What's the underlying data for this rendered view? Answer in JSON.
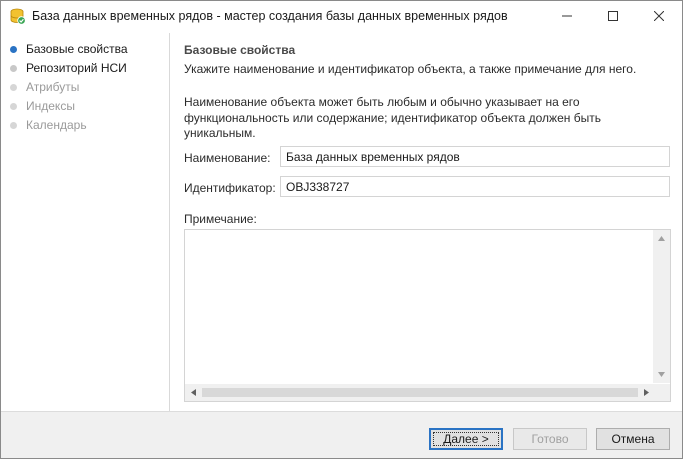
{
  "window": {
    "title": "База данных временных рядов - мастер создания базы данных временных рядов"
  },
  "steps": [
    {
      "label": "Базовые свойства",
      "state": "active"
    },
    {
      "label": "Репозиторий НСИ",
      "state": "done"
    },
    {
      "label": "Атрибуты",
      "state": "pending"
    },
    {
      "label": "Индексы",
      "state": "pending"
    },
    {
      "label": "Календарь",
      "state": "pending"
    }
  ],
  "main": {
    "heading": "Базовые свойства",
    "subtitle": "Укажите наименование и идентификатор объекта, а также примечание для него.",
    "description": "Наименование объекта может быть любым и обычно указывает на его функциональность или содержание; идентификатор объекта должен быть уникальным.",
    "name_label": "Наименование:",
    "name_value": "База данных временных рядов",
    "id_label": "Идентификатор:",
    "id_value": "OBJ338727",
    "note_label": "Примечание:",
    "note_value": ""
  },
  "footer": {
    "next_label": "Далее >",
    "done_label": "Готово",
    "cancel_label": "Отмена"
  },
  "colors": {
    "accent": "#2a73c4",
    "disabled_text": "#9a9a9a"
  },
  "icons": {
    "app": "database-icon",
    "minimize": "minimize-icon",
    "maximize": "maximize-icon",
    "close": "close-icon"
  }
}
